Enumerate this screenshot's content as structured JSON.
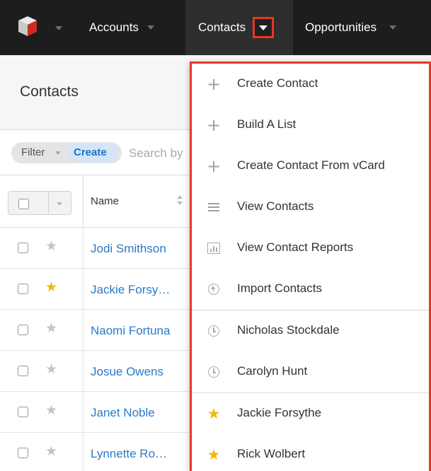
{
  "nav": {
    "tabs": [
      {
        "label": "Accounts"
      },
      {
        "label": "Contacts"
      },
      {
        "label": "Opportunities"
      }
    ],
    "accent_color": "#e8371e"
  },
  "page": {
    "title": "Contacts"
  },
  "filter": {
    "filter_label": "Filter",
    "create_label": "Create",
    "search_placeholder": "Search by"
  },
  "table": {
    "columns": [
      "Name"
    ],
    "rows": [
      {
        "name": "Jodi Smithson",
        "favorite": false
      },
      {
        "name": "Jackie Forsy…",
        "favorite": true
      },
      {
        "name": "Naomi Fortuna",
        "favorite": false
      },
      {
        "name": "Josue Owens",
        "favorite": false
      },
      {
        "name": "Janet Noble",
        "favorite": false
      },
      {
        "name": "Lynnette Ro…",
        "favorite": false
      }
    ]
  },
  "dropdown": {
    "actions": [
      {
        "label": "Create Contact",
        "icon": "plus-icon"
      },
      {
        "label": "Build A List",
        "icon": "plus-icon"
      },
      {
        "label": "Create Contact From vCard",
        "icon": "plus-icon"
      },
      {
        "label": "View Contacts",
        "icon": "list-icon"
      },
      {
        "label": "View Contact Reports",
        "icon": "report-icon"
      },
      {
        "label": "Import Contacts",
        "icon": "upload-icon"
      }
    ],
    "recently_viewed": [
      {
        "label": "Nicholas Stockdale",
        "icon": "clock-icon"
      },
      {
        "label": "Carolyn Hunt",
        "icon": "clock-icon"
      }
    ],
    "favorites": [
      {
        "label": "Jackie Forsythe",
        "icon": "star-icon"
      },
      {
        "label": "Rick Wolbert",
        "icon": "star-icon"
      }
    ]
  }
}
